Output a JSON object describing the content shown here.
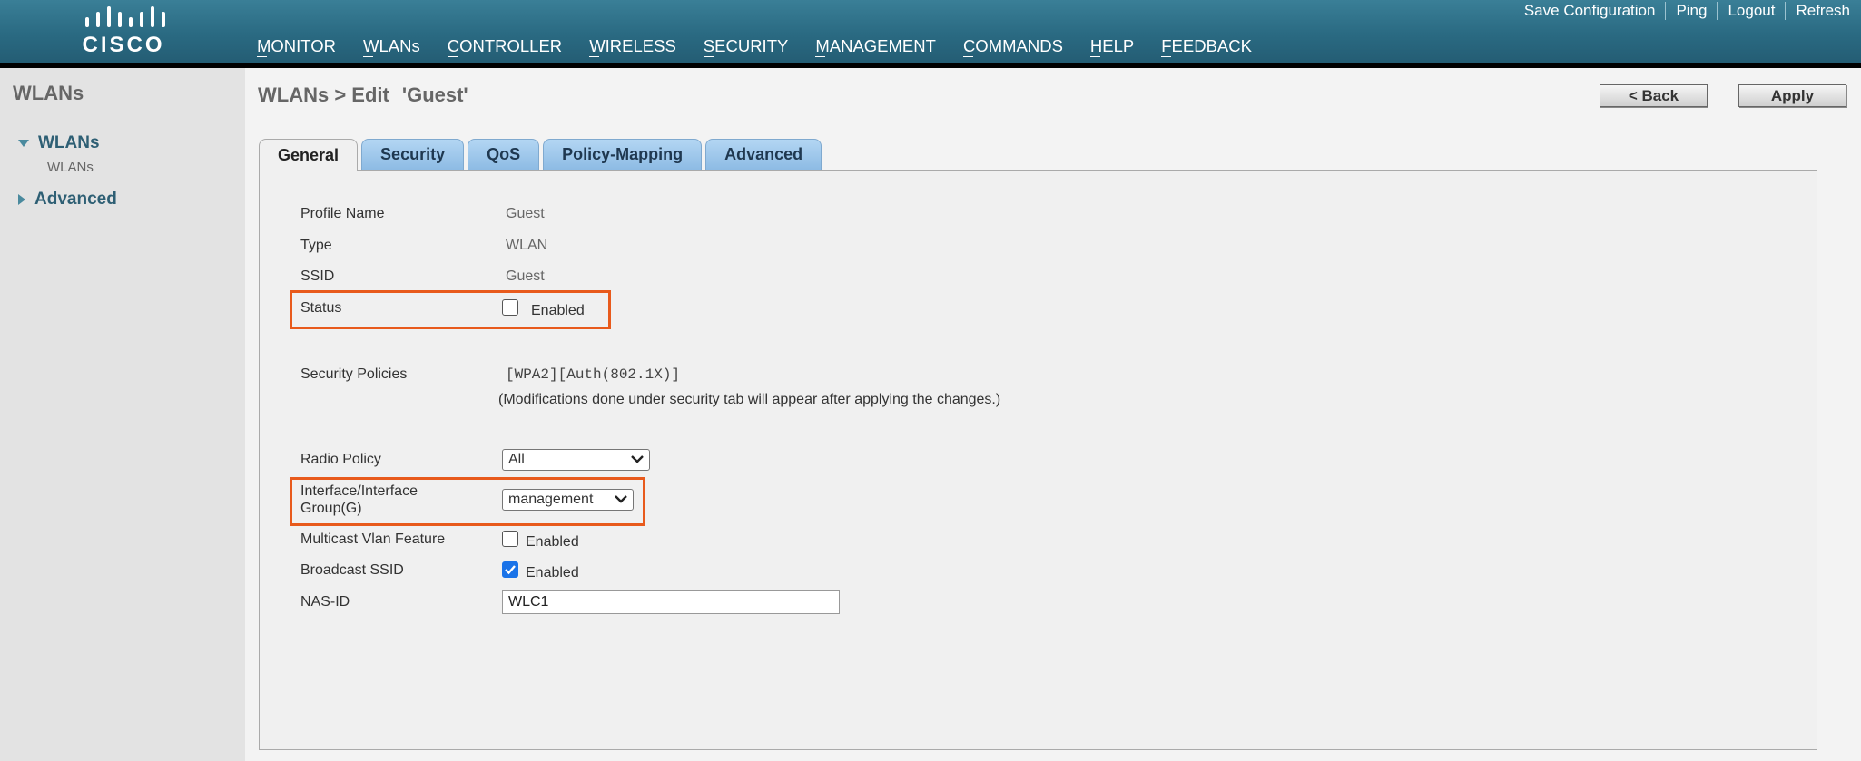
{
  "header": {
    "logo_text": "CISCO",
    "utility_links": [
      "Save Configuration",
      "Ping",
      "Logout",
      "Refresh"
    ],
    "nav": [
      "MONITOR",
      "WLANs",
      "CONTROLLER",
      "WIRELESS",
      "SECURITY",
      "MANAGEMENT",
      "COMMANDS",
      "HELP",
      "FEEDBACK"
    ],
    "active_nav": "WLANs",
    "colors": {
      "bar": "#2a6a82",
      "active_indicator": "#f5a623"
    }
  },
  "sidebar": {
    "title": "WLANs",
    "items": [
      {
        "label": "WLANs",
        "expanded": true,
        "children": [
          "WLANs"
        ]
      },
      {
        "label": "Advanced",
        "expanded": false
      }
    ]
  },
  "page": {
    "title": "WLANs > Edit",
    "wlan_name": "'Guest'",
    "back_label": "< Back",
    "apply_label": "Apply"
  },
  "tabs": [
    "General",
    "Security",
    "QoS",
    "Policy-Mapping",
    "Advanced"
  ],
  "active_tab": "General",
  "form": {
    "profile_name": {
      "label": "Profile Name",
      "value": "Guest"
    },
    "type": {
      "label": "Type",
      "value": "WLAN"
    },
    "ssid": {
      "label": "SSID",
      "value": "Guest"
    },
    "status": {
      "label": "Status",
      "checkbox_label": "Enabled",
      "checked": false
    },
    "security_policies": {
      "label": "Security Policies",
      "value": "[WPA2][Auth(802.1X)]",
      "note": "(Modifications done under security tab will appear after applying the changes.)"
    },
    "radio_policy": {
      "label": "Radio Policy",
      "selected": "All"
    },
    "interface": {
      "label_line1": "Interface/Interface",
      "label_line2": "Group(G)",
      "selected": "management"
    },
    "multicast_vlan": {
      "label": "Multicast Vlan Feature",
      "checkbox_label": "Enabled",
      "checked": false
    },
    "broadcast_ssid": {
      "label": "Broadcast SSID",
      "checkbox_label": "Enabled",
      "checked": true
    },
    "nas_id": {
      "label": "NAS-ID",
      "value": "WLC1"
    }
  },
  "highlight_color": "#e85a1c"
}
